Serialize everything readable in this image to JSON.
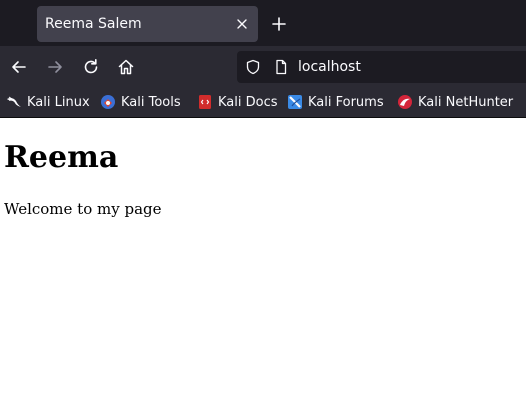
{
  "tab": {
    "title": "Reema Salem"
  },
  "address_bar": {
    "url": "localhost"
  },
  "bookmarks": [
    {
      "label": "Kali Linux",
      "icon": "kali-dragon-icon"
    },
    {
      "label": "Kali Tools",
      "icon": "kali-tools-icon"
    },
    {
      "label": "Kali Docs",
      "icon": "kali-docs-icon"
    },
    {
      "label": "Kali Forums",
      "icon": "kali-forums-icon"
    },
    {
      "label": "Kali NetHunter",
      "icon": "kali-nethunter-icon"
    }
  ],
  "page": {
    "heading": "Reema",
    "text": "Welcome to my page"
  },
  "colors": {
    "tabstrip_bg": "#1c1b22",
    "toolbar_bg": "#2b2a33",
    "active_tab_bg": "#42414d",
    "toolbar_text": "#fbfbfe"
  }
}
